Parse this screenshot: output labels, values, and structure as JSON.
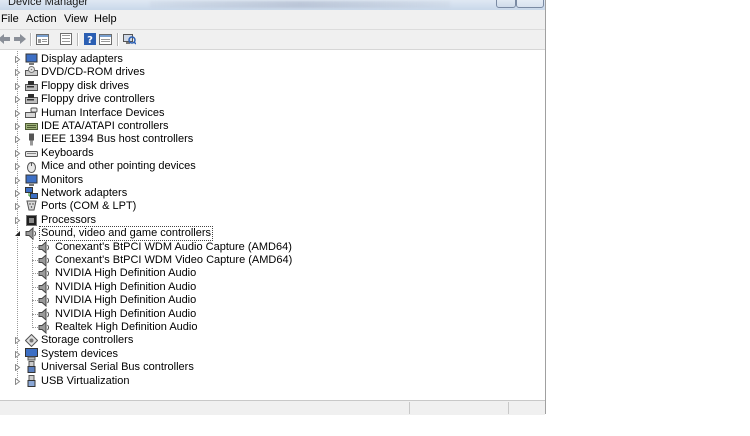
{
  "window": {
    "title": "Device Manager"
  },
  "menu": [
    "File",
    "Action",
    "View",
    "Help"
  ],
  "toolbar": {
    "buttons": [
      "back-icon",
      "forward-icon",
      "properties-view-icon",
      "console-tree-icon",
      "help-icon",
      "show-hide-icon",
      "scan-hardware-icon"
    ]
  },
  "tree": {
    "categories": [
      {
        "label": "Display adapters",
        "icon": "monitor-icon"
      },
      {
        "label": "DVD/CD-ROM drives",
        "icon": "dvd-drive-icon"
      },
      {
        "label": "Floppy disk drives",
        "icon": "floppy-disk-icon"
      },
      {
        "label": "Floppy drive controllers",
        "icon": "floppy-controller-icon"
      },
      {
        "label": "Human Interface Devices",
        "icon": "hid-icon"
      },
      {
        "label": "IDE ATA/ATAPI controllers",
        "icon": "ide-controller-icon"
      },
      {
        "label": "IEEE 1394 Bus host controllers",
        "icon": "firewire-icon"
      },
      {
        "label": "Keyboards",
        "icon": "keyboard-icon"
      },
      {
        "label": "Mice and other pointing devices",
        "icon": "mouse-icon"
      },
      {
        "label": "Monitors",
        "icon": "monitor-icon"
      },
      {
        "label": "Network adapters",
        "icon": "network-adapter-icon"
      },
      {
        "label": "Ports (COM & LPT)",
        "icon": "port-icon"
      },
      {
        "label": "Processors",
        "icon": "processor-icon"
      },
      {
        "label": "Sound, video and game controllers",
        "icon": "speaker-icon",
        "expanded": true,
        "selected": true
      },
      {
        "label": "Storage controllers",
        "icon": "storage-controller-icon"
      },
      {
        "label": "System devices",
        "icon": "system-device-icon"
      },
      {
        "label": "Universal Serial Bus controllers",
        "icon": "usb-icon"
      },
      {
        "label": "USB Virtualization",
        "icon": "usb-virtualization-icon"
      }
    ],
    "sound_children": [
      "Conexant's BtPCI WDM Audio Capture (AMD64)",
      "Conexant's BtPCI WDM Video Capture (AMD64)",
      "NVIDIA High Definition Audio",
      "NVIDIA High Definition Audio",
      "NVIDIA High Definition Audio",
      "NVIDIA High Definition Audio",
      "Realtek High Definition Audio"
    ]
  }
}
